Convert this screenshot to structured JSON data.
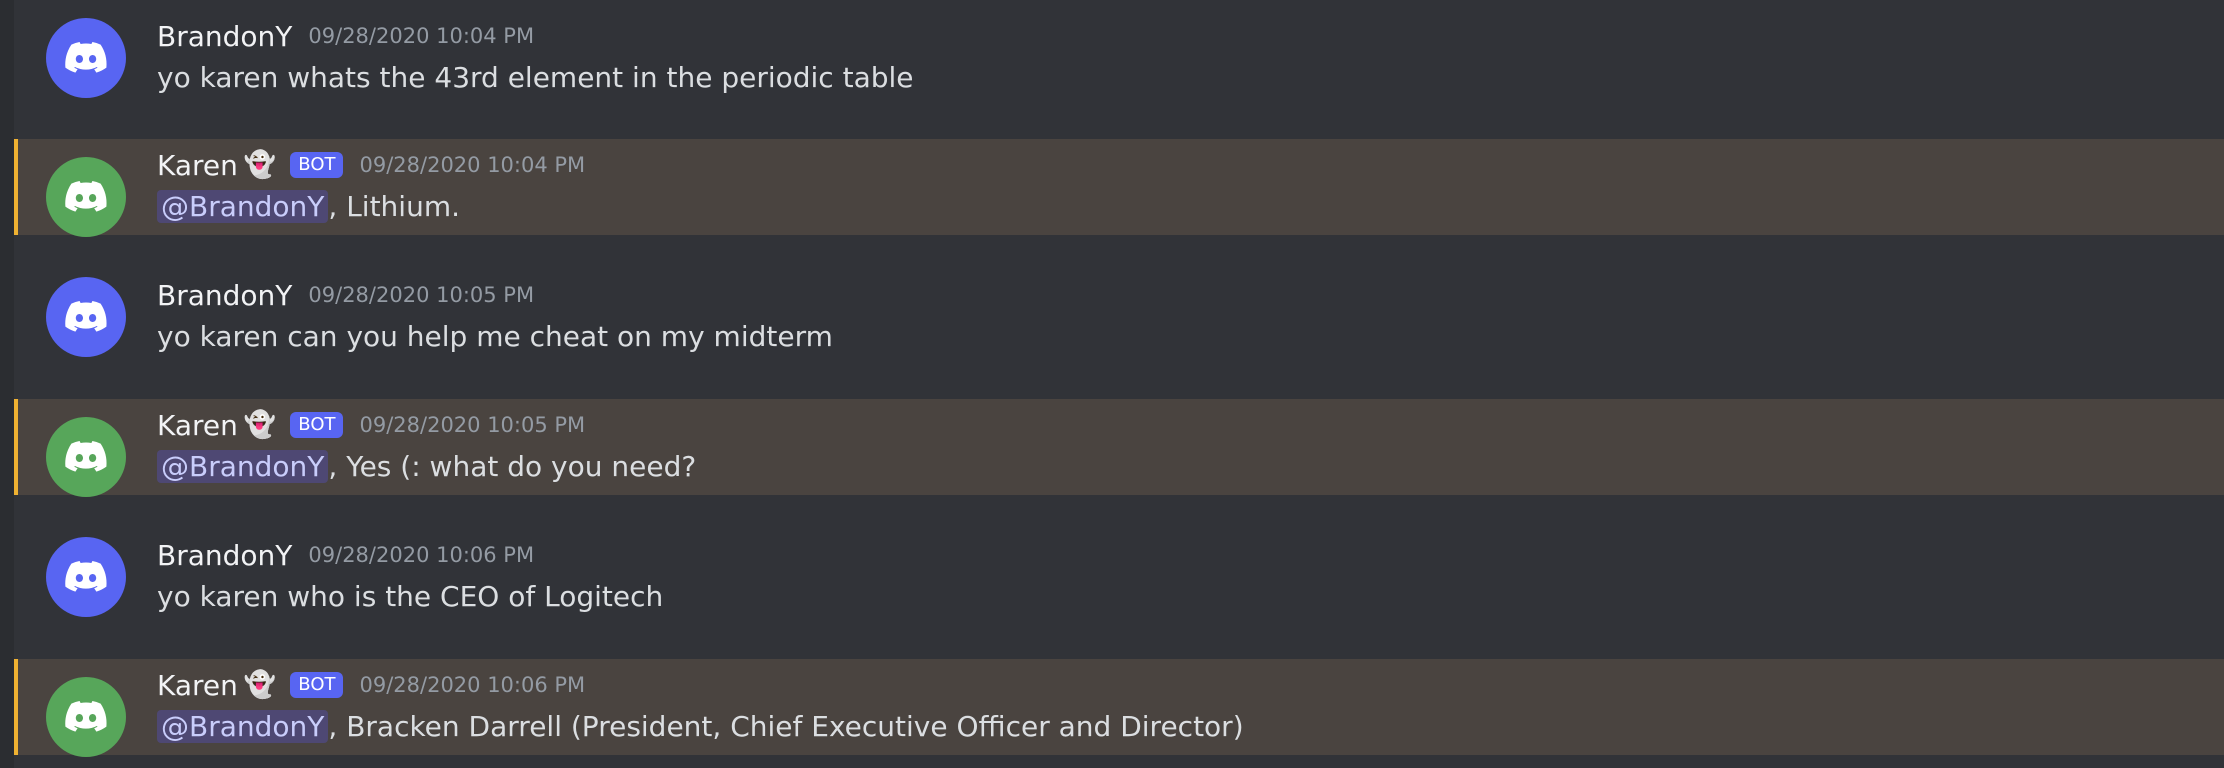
{
  "colors": {
    "background": "#313338",
    "highlight_background": "#4a4440",
    "highlight_border": "#f0b232",
    "avatar_blue": "#5865f2",
    "avatar_green": "#57a65a",
    "bot_tag": "#5865f2",
    "mention_bg": "#4e4873",
    "mention_text": "#c9cdfb"
  },
  "messages": [
    {
      "username": "BrandonY",
      "timestamp": "09/28/2020 10:04 PM",
      "text": "yo karen whats the 43rd element in the periodic table",
      "avatar_icon": "discord-logo-icon"
    },
    {
      "username": "Karen",
      "emoji": "👻",
      "bot_tag": "BOT",
      "timestamp": "09/28/2020 10:04 PM",
      "mention": "@BrandonY",
      "text": ", Lithium.",
      "avatar_icon": "discord-logo-icon"
    },
    {
      "username": "BrandonY",
      "timestamp": "09/28/2020 10:05 PM",
      "text": "yo karen can you help me cheat on my midterm",
      "avatar_icon": "discord-logo-icon"
    },
    {
      "username": "Karen",
      "emoji": "👻",
      "bot_tag": "BOT",
      "timestamp": "09/28/2020 10:05 PM",
      "mention": "@BrandonY",
      "text": ", Yes (: what do you need?",
      "avatar_icon": "discord-logo-icon"
    },
    {
      "username": "BrandonY",
      "timestamp": "09/28/2020 10:06 PM",
      "text": "yo karen who is the CEO of Logitech",
      "avatar_icon": "discord-logo-icon"
    },
    {
      "username": "Karen",
      "emoji": "👻",
      "bot_tag": "BOT",
      "timestamp": "09/28/2020 10:06 PM",
      "mention": "@BrandonY",
      "text": ", Bracken Darrell (President, Chief Executive Officer and Director)",
      "avatar_icon": "discord-logo-icon"
    }
  ]
}
